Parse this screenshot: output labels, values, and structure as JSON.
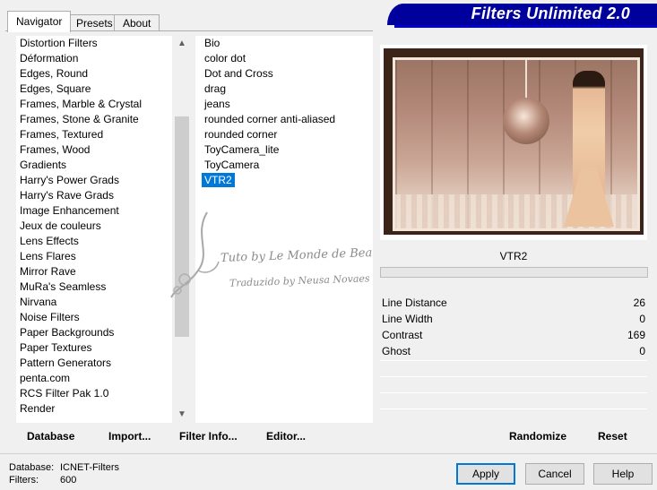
{
  "header": {
    "title": "Filters Unlimited 2.0"
  },
  "tabs": [
    {
      "label": "Navigator",
      "active": true
    },
    {
      "label": "Presets",
      "active": false
    },
    {
      "label": "About",
      "active": false
    }
  ],
  "categories": [
    "Distortion Filters",
    "Déformation",
    "Edges, Round",
    "Edges, Square",
    "Frames, Marble & Crystal",
    "Frames, Stone & Granite",
    "Frames, Textured",
    "Frames, Wood",
    "Gradients",
    "Harry's Power Grads",
    "Harry's Rave Grads",
    "Image Enhancement",
    "Jeux de couleurs",
    "Lens Effects",
    "Lens Flares",
    "Mirror Rave",
    "MuRa's Seamless",
    "Nirvana",
    "Noise Filters",
    "Paper Backgrounds",
    "Paper Textures",
    "Pattern Generators",
    "penta.com",
    "RCS Filter Pak 1.0",
    "Render"
  ],
  "filters": [
    "Bio",
    "color dot",
    "Dot and Cross",
    "drag",
    "jeans",
    "rounded corner anti-aliased",
    "rounded corner",
    "ToyCamera_lite",
    "ToyCamera",
    "VTR2"
  ],
  "selected_filter": "VTR2",
  "params": [
    {
      "label": "Line Distance",
      "value": "26"
    },
    {
      "label": "Line Width",
      "value": "0"
    },
    {
      "label": "Contrast",
      "value": "169"
    },
    {
      "label": "Ghost",
      "value": "0"
    }
  ],
  "bottom_left": {
    "database": "Database",
    "import": "Import...",
    "filter_info": "Filter Info...",
    "editor": "Editor..."
  },
  "bottom_right": {
    "randomize": "Randomize",
    "reset": "Reset"
  },
  "info": {
    "database_label": "Database:",
    "database_value": "ICNET-Filters",
    "filters_label": "Filters:",
    "filters_value": "600"
  },
  "buttons": {
    "apply": "Apply",
    "cancel": "Cancel",
    "help": "Help"
  },
  "watermark": {
    "line1": "Tuto by Le Monde de Bea",
    "line2": "Traduzido by Neusa Novaes"
  },
  "colors": {
    "header_blue": "#00009c",
    "selection": "#0078d7"
  }
}
